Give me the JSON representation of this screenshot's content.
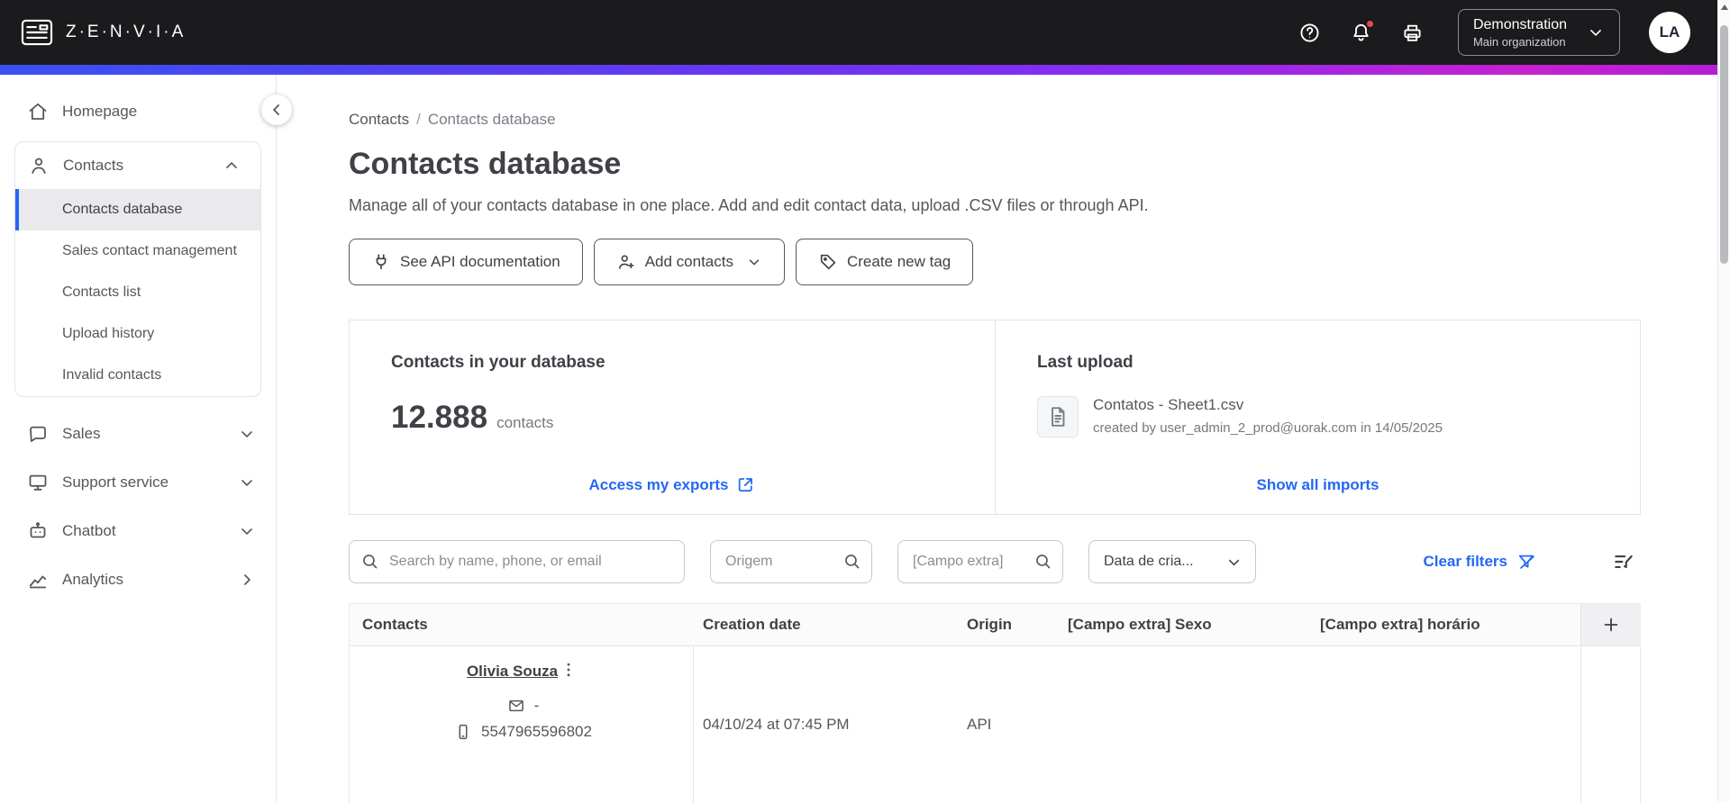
{
  "colors": {
    "accent": "#2467F5",
    "topbar_bg": "#1B1B1E",
    "gradient_start": "#3A50F3",
    "gradient_mid": "#8F2BEF",
    "gradient_end": "#C621CE",
    "notification": "#E5484D",
    "text_dark": "#3F4147",
    "text_body": "#55575E",
    "text_muted": "#76787F",
    "border": "#E3E4E8",
    "active_item_bg": "#EAEAEC"
  },
  "topbar": {
    "brand": "Z·E·N·V·I·A",
    "org_name": "Demonstration",
    "org_subtitle": "Main organization",
    "avatar_initials": "LA"
  },
  "sidebar": {
    "homepage": "Homepage",
    "contacts_group": {
      "label": "Contacts",
      "items": [
        {
          "label": "Contacts database",
          "active": true
        },
        {
          "label": "Sales contact management",
          "active": false
        },
        {
          "label": "Contacts list",
          "active": false
        },
        {
          "label": "Upload history",
          "active": false
        },
        {
          "label": "Invalid contacts",
          "active": false
        }
      ]
    },
    "sales": "Sales",
    "support": "Support service",
    "chatbot": "Chatbot",
    "analytics": "Analytics"
  },
  "breadcrumb": {
    "parent": "Contacts",
    "separator": "/",
    "current": "Contacts database"
  },
  "page": {
    "title": "Contacts database",
    "subtitle": "Manage all of your contacts database in one place. Add and edit contact data, upload .CSV files or through API."
  },
  "actions": {
    "api_docs": "See API documentation",
    "add_contacts": "Add contacts",
    "create_tag": "Create new tag"
  },
  "stats_card": {
    "title": "Contacts in your database",
    "count": "12.888",
    "unit": "contacts",
    "link": "Access my exports"
  },
  "upload_card": {
    "title": "Last upload",
    "file_name": "Contatos - Sheet1.csv",
    "file_meta": "created by user_admin_2_prod@uorak.com in 14/05/2025",
    "link": "Show all imports"
  },
  "filters": {
    "search_placeholder": "Search by name, phone, or email",
    "origin_placeholder": "Origem",
    "extra_placeholder": "[Campo extra]",
    "date_label": "Data de cria...",
    "clear": "Clear filters"
  },
  "table": {
    "headers": [
      "Contacts",
      "Creation date",
      "Origin",
      "[Campo extra] Sexo",
      "[Campo extra] horário"
    ],
    "add_column": "+",
    "rows": [
      {
        "name": "Olivia Souza",
        "email": "-",
        "phone": "5547965596802",
        "creation_date": "04/10/24 at 07:45 PM",
        "origin": "API",
        "sexo": "",
        "horario": ""
      }
    ]
  }
}
